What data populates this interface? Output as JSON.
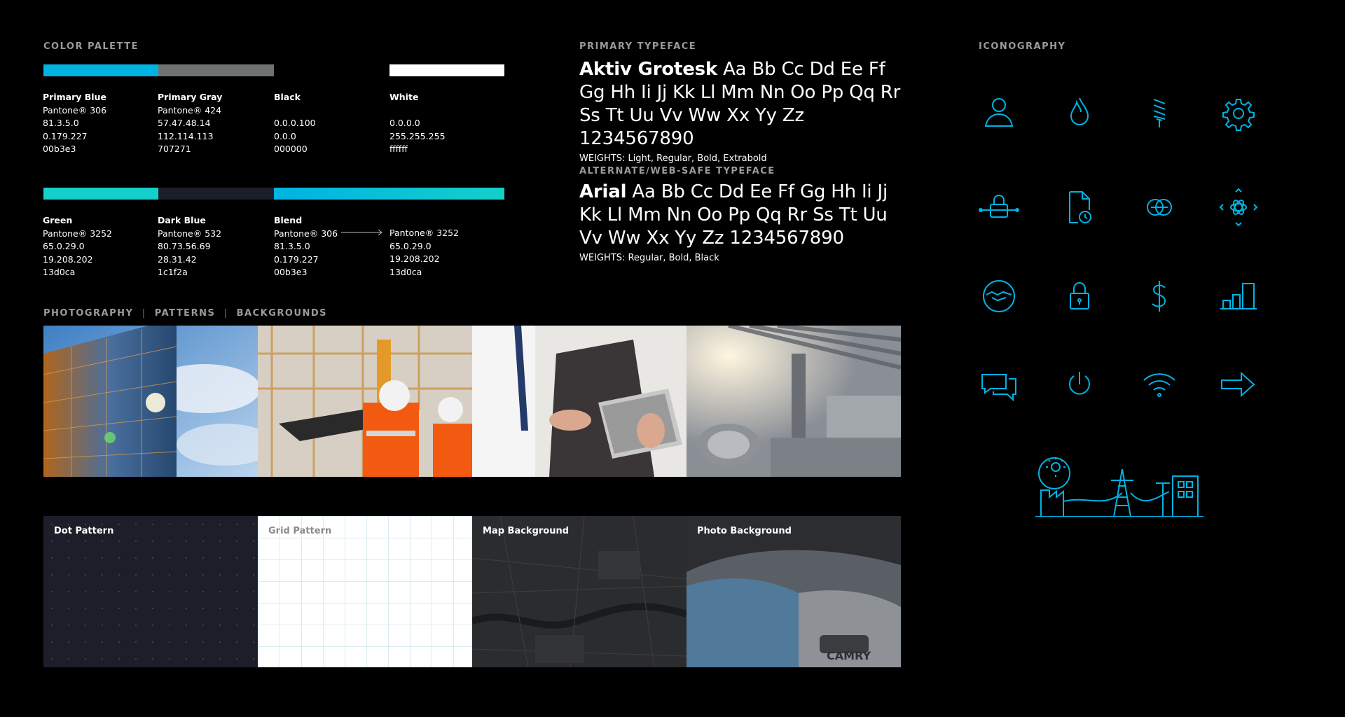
{
  "palette": {
    "title": "COLOR PALETTE",
    "colors": {
      "primary_blue": "#00b3e3",
      "primary_gray": "#707271",
      "black": "#000000",
      "white": "#ffffff",
      "green": "#13d0ca",
      "dark_blue": "#1c1f2a"
    },
    "swatches": [
      {
        "name": "Primary Blue",
        "lines": [
          "Pantone® 306",
          "81.3.5.0",
          "0.179.227",
          "00b3e3"
        ]
      },
      {
        "name": "Primary Gray",
        "lines": [
          "Pantone® 424",
          "57.47.48.14",
          "112.114.113",
          "707271"
        ]
      },
      {
        "name": "Black",
        "lines": [
          "",
          "0.0.0.100",
          "0.0.0",
          "000000"
        ]
      },
      {
        "name": "White",
        "lines": [
          "",
          "0.0.0.0",
          "255.255.255",
          "ffffff"
        ]
      },
      {
        "name": "Green",
        "lines": [
          "Pantone® 3252",
          "65.0.29.0",
          "19.208.202",
          "13d0ca"
        ]
      },
      {
        "name": "Dark Blue",
        "lines": [
          "Pantone® 532",
          "80.73.56.69",
          "28.31.42",
          "1c1f2a"
        ]
      },
      {
        "name": "Blend",
        "lines": [
          "Pantone® 306",
          "81.3.5.0",
          "0.179.227",
          "00b3e3"
        ]
      },
      {
        "name": "",
        "lines": [
          "Pantone® 3252",
          "65.0.29.0",
          "19.208.202",
          "13d0ca"
        ]
      }
    ]
  },
  "typography": {
    "primary_title": "PRIMARY TYPEFACE",
    "primary_name": "Aktiv Grotesk",
    "primary_specimen": " Aa Bb Cc Dd Ee Ff Gg Hh Ii Jj Kk Ll Mm Nn Oo Pp Qq Rr Ss Tt Uu Vv Ww Xx Yy Zz 1234567890",
    "primary_weights": "WEIGHTS: Light, Regular, Bold, Extrabold",
    "alt_title": "ALTERNATE/WEB-SAFE TYPEFACE",
    "alt_name": "Arial",
    "alt_specimen": " Aa Bb Cc Dd Ee Ff Gg Hh Ii Jj Kk Ll Mm Nn Oo Pp Qq Rr Ss Tt Uu Vv Ww Xx Yy Zz 1234567890",
    "alt_weights": "WEIGHTS: Regular, Bold, Black"
  },
  "photography": {
    "title_parts": [
      "PHOTOGRAPHY",
      "PATTERNS",
      "BACKGROUNDS"
    ],
    "photos": [
      "glass-building",
      "construction-workers",
      "tablet-business",
      "industrial-interior"
    ],
    "patterns": [
      "Dot Pattern",
      "Grid Pattern",
      "Map Background",
      "Photo Background"
    ]
  },
  "iconography": {
    "title": "ICONOGRAPHY",
    "icon_color": "#00b3e3",
    "icons": [
      "user-icon",
      "flame-icon",
      "coil-icon",
      "gear-icon",
      "network-lock-icon",
      "document-timer-icon",
      "overlapping-circles-icon",
      "atom-arrows-icon",
      "handshake-icon",
      "lock-icon",
      "dollar-icon",
      "bar-chart-icon",
      "chat-icon",
      "power-icon",
      "wifi-icon",
      "arrow-right-icon"
    ],
    "illustration": "energy-infrastructure-illustration"
  }
}
